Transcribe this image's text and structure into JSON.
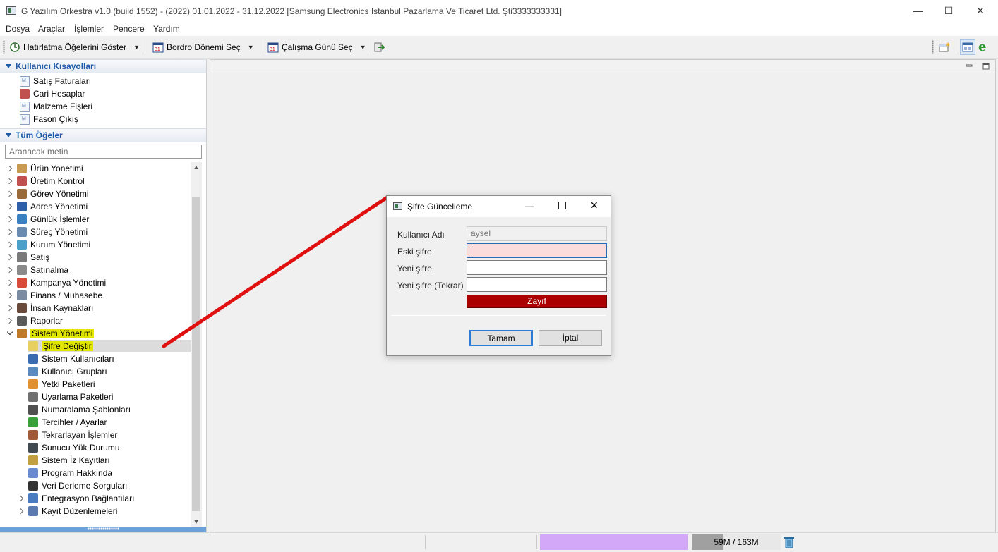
{
  "window": {
    "title": "G Yazılım Orkestra v1.0 (build 1552) - (2022) 01.01.2022 - 31.12.2022 [Samsung Electronics Istanbul Pazarlama Ve Ticaret Ltd. Şti3333333331]",
    "minimize": "—",
    "maximize": "☐",
    "close": "✕"
  },
  "menu": [
    "Dosya",
    "Araçlar",
    "İşlemler",
    "Pencere",
    "Yardım"
  ],
  "toolbar": {
    "reminders": "Hatırlatma Öğelerini Göster",
    "payroll": "Bordro Dönemi Seç",
    "workday": "Çalışma Günü Seç",
    "calendar_day": "31"
  },
  "shortcuts": {
    "header": "Kullanıcı Kısayolları",
    "items": [
      "Satış Faturaları",
      "Cari Hesaplar",
      "Malzeme Fişleri",
      "Fason Çıkış"
    ]
  },
  "all_items": {
    "header": "Tüm Öğeler",
    "search_placeholder": "Aranacak metin"
  },
  "tree": {
    "top": [
      {
        "label": "Ürün Yonetimi",
        "color": "#c89a52"
      },
      {
        "label": "Üretim Kontrol",
        "color": "#c0504d"
      },
      {
        "label": "Görev Yönetimi",
        "color": "#9a6a3a"
      },
      {
        "label": "Adres Yönetimi",
        "color": "#2e5fa8"
      },
      {
        "label": "Günlük İşlemler",
        "color": "#3a7fc0"
      },
      {
        "label": "Süreç Yönetimi",
        "color": "#6a8bb0"
      },
      {
        "label": "Kurum Yönetimi",
        "color": "#4aa0c8"
      },
      {
        "label": "Satış",
        "color": "#7a7a7a"
      },
      {
        "label": "Satınalma",
        "color": "#8a8a8a"
      },
      {
        "label": "Kampanya Yönetimi",
        "color": "#d84a3a"
      },
      {
        "label": "Finans / Muhasebe",
        "color": "#7a8aa0"
      },
      {
        "label": "İnsan Kaynakları",
        "color": "#6a4a3a"
      },
      {
        "label": "Raporlar",
        "color": "#5a5a5a"
      }
    ],
    "expanded": {
      "label": "Sistem Yönetimi",
      "color": "#c07a2a"
    },
    "children": [
      {
        "label": "Şifre Değiştir",
        "color": "#e8d060"
      },
      {
        "label": "Sistem Kullanıcıları",
        "color": "#3a6ab0"
      },
      {
        "label": "Kullanıcı Grupları",
        "color": "#5a8ac0"
      },
      {
        "label": "Yetki Paketleri",
        "color": "#e09030"
      },
      {
        "label": "Uyarlama Paketleri",
        "color": "#707070"
      },
      {
        "label": "Numaralama Şablonları",
        "color": "#505050"
      },
      {
        "label": "Tercihler / Ayarlar",
        "color": "#3aa03a"
      },
      {
        "label": "Tekrarlayan İşlemler",
        "color": "#a05a3a"
      },
      {
        "label": "Sunucu Yük Durumu",
        "color": "#404a50"
      },
      {
        "label": "Sistem İz Kayıtları",
        "color": "#c0a040"
      },
      {
        "label": "Program Hakkında",
        "color": "#6a8ad0"
      },
      {
        "label": "Veri Derleme Sorguları",
        "color": "#333333"
      },
      {
        "label": "Entegrasyon Bağlantıları",
        "color": "#4a7ac0"
      },
      {
        "label": "Kayıt Düzenlemeleri",
        "color": "#5a7ab0"
      }
    ]
  },
  "dialog": {
    "title": "Şifre Güncelleme",
    "username_label": "Kullanıcı Adı",
    "username_value": "aysel",
    "old_password_label": "Eski şifre",
    "new_password_label": "Yeni şifre",
    "confirm_password_label": "Yeni şifre (Tekrar)",
    "strength": "Zayıf",
    "ok": "Tamam",
    "cancel": "İptal"
  },
  "status": {
    "memory": "59M / 163M",
    "memory_used_fraction": 0.36
  },
  "colors": {
    "highlight": "#e2e600",
    "strength_bar": "#aa0000",
    "arrow": "#e01010",
    "status_purple": "#d4a8f8"
  }
}
